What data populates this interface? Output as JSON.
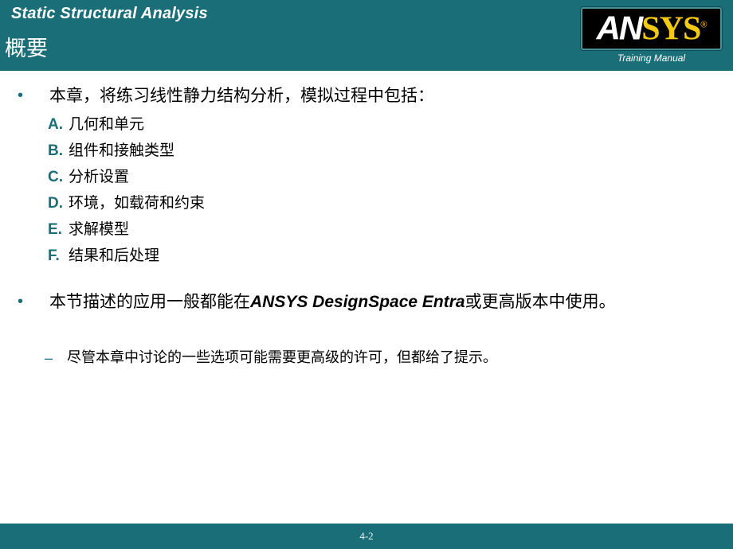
{
  "header": {
    "title": "Static Structural Analysis",
    "subtitle": "概要",
    "logo": {
      "part1": "AN",
      "part2": "SYS",
      "registered": "®",
      "caption": "Training Manual"
    }
  },
  "content": {
    "bullet_1": "本章，将练习线性静力结构分析，模拟过程中包括：",
    "lettered_items": [
      {
        "marker": "A.",
        "label": "几何和单元"
      },
      {
        "marker": "B.",
        "label": "组件和接触类型"
      },
      {
        "marker": "C.",
        "label": "分析设置"
      },
      {
        "marker": "D.",
        "label": "环境，如载荷和约束"
      },
      {
        "marker": "E.",
        "label": "求解模型"
      },
      {
        "marker": "F.",
        "label": "结果和后处理"
      }
    ],
    "bullet_2": {
      "prefix": "本节描述的应用一般都能在",
      "emphasis": "ANSYS DesignSpace Entra",
      "suffix": "或更高版本中使用。"
    },
    "sub_bullet_1": "尽管本章中讨论的一些选项可能需要更高级的许可，但都给了提示。",
    "bullet_marker": "•",
    "dash_marker": "–"
  },
  "footer": {
    "page_number": "4-2"
  },
  "colors": {
    "teal": "#1a6e78",
    "logo_gold": "#f3c913",
    "logo_black": "#000000"
  }
}
